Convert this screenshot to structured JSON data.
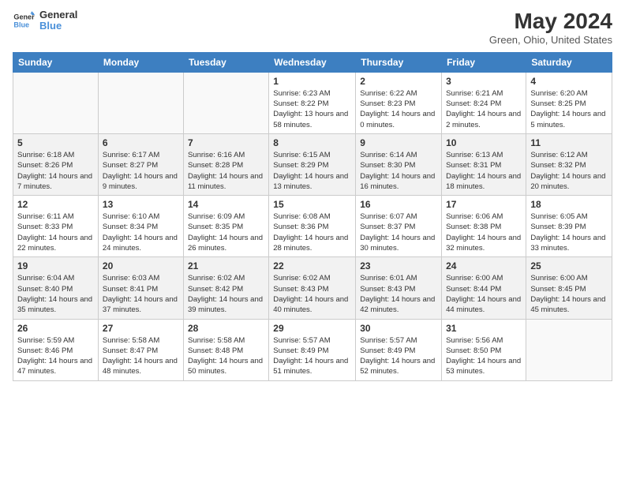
{
  "header": {
    "logo_line1": "General",
    "logo_line2": "Blue",
    "title": "May 2024",
    "subtitle": "Green, Ohio, United States"
  },
  "days_of_week": [
    "Sunday",
    "Monday",
    "Tuesday",
    "Wednesday",
    "Thursday",
    "Friday",
    "Saturday"
  ],
  "weeks": [
    [
      {
        "day": "",
        "empty": true
      },
      {
        "day": "",
        "empty": true
      },
      {
        "day": "",
        "empty": true
      },
      {
        "day": "1",
        "sunrise": "6:23 AM",
        "sunset": "8:22 PM",
        "daylight": "13 hours and 58 minutes."
      },
      {
        "day": "2",
        "sunrise": "6:22 AM",
        "sunset": "8:23 PM",
        "daylight": "14 hours and 0 minutes."
      },
      {
        "day": "3",
        "sunrise": "6:21 AM",
        "sunset": "8:24 PM",
        "daylight": "14 hours and 2 minutes."
      },
      {
        "day": "4",
        "sunrise": "6:20 AM",
        "sunset": "8:25 PM",
        "daylight": "14 hours and 5 minutes."
      }
    ],
    [
      {
        "day": "5",
        "sunrise": "6:18 AM",
        "sunset": "8:26 PM",
        "daylight": "14 hours and 7 minutes."
      },
      {
        "day": "6",
        "sunrise": "6:17 AM",
        "sunset": "8:27 PM",
        "daylight": "14 hours and 9 minutes."
      },
      {
        "day": "7",
        "sunrise": "6:16 AM",
        "sunset": "8:28 PM",
        "daylight": "14 hours and 11 minutes."
      },
      {
        "day": "8",
        "sunrise": "6:15 AM",
        "sunset": "8:29 PM",
        "daylight": "14 hours and 13 minutes."
      },
      {
        "day": "9",
        "sunrise": "6:14 AM",
        "sunset": "8:30 PM",
        "daylight": "14 hours and 16 minutes."
      },
      {
        "day": "10",
        "sunrise": "6:13 AM",
        "sunset": "8:31 PM",
        "daylight": "14 hours and 18 minutes."
      },
      {
        "day": "11",
        "sunrise": "6:12 AM",
        "sunset": "8:32 PM",
        "daylight": "14 hours and 20 minutes."
      }
    ],
    [
      {
        "day": "12",
        "sunrise": "6:11 AM",
        "sunset": "8:33 PM",
        "daylight": "14 hours and 22 minutes."
      },
      {
        "day": "13",
        "sunrise": "6:10 AM",
        "sunset": "8:34 PM",
        "daylight": "14 hours and 24 minutes."
      },
      {
        "day": "14",
        "sunrise": "6:09 AM",
        "sunset": "8:35 PM",
        "daylight": "14 hours and 26 minutes."
      },
      {
        "day": "15",
        "sunrise": "6:08 AM",
        "sunset": "8:36 PM",
        "daylight": "14 hours and 28 minutes."
      },
      {
        "day": "16",
        "sunrise": "6:07 AM",
        "sunset": "8:37 PM",
        "daylight": "14 hours and 30 minutes."
      },
      {
        "day": "17",
        "sunrise": "6:06 AM",
        "sunset": "8:38 PM",
        "daylight": "14 hours and 32 minutes."
      },
      {
        "day": "18",
        "sunrise": "6:05 AM",
        "sunset": "8:39 PM",
        "daylight": "14 hours and 33 minutes."
      }
    ],
    [
      {
        "day": "19",
        "sunrise": "6:04 AM",
        "sunset": "8:40 PM",
        "daylight": "14 hours and 35 minutes."
      },
      {
        "day": "20",
        "sunrise": "6:03 AM",
        "sunset": "8:41 PM",
        "daylight": "14 hours and 37 minutes."
      },
      {
        "day": "21",
        "sunrise": "6:02 AM",
        "sunset": "8:42 PM",
        "daylight": "14 hours and 39 minutes."
      },
      {
        "day": "22",
        "sunrise": "6:02 AM",
        "sunset": "8:43 PM",
        "daylight": "14 hours and 40 minutes."
      },
      {
        "day": "23",
        "sunrise": "6:01 AM",
        "sunset": "8:43 PM",
        "daylight": "14 hours and 42 minutes."
      },
      {
        "day": "24",
        "sunrise": "6:00 AM",
        "sunset": "8:44 PM",
        "daylight": "14 hours and 44 minutes."
      },
      {
        "day": "25",
        "sunrise": "6:00 AM",
        "sunset": "8:45 PM",
        "daylight": "14 hours and 45 minutes."
      }
    ],
    [
      {
        "day": "26",
        "sunrise": "5:59 AM",
        "sunset": "8:46 PM",
        "daylight": "14 hours and 47 minutes."
      },
      {
        "day": "27",
        "sunrise": "5:58 AM",
        "sunset": "8:47 PM",
        "daylight": "14 hours and 48 minutes."
      },
      {
        "day": "28",
        "sunrise": "5:58 AM",
        "sunset": "8:48 PM",
        "daylight": "14 hours and 50 minutes."
      },
      {
        "day": "29",
        "sunrise": "5:57 AM",
        "sunset": "8:49 PM",
        "daylight": "14 hours and 51 minutes."
      },
      {
        "day": "30",
        "sunrise": "5:57 AM",
        "sunset": "8:49 PM",
        "daylight": "14 hours and 52 minutes."
      },
      {
        "day": "31",
        "sunrise": "5:56 AM",
        "sunset": "8:50 PM",
        "daylight": "14 hours and 53 minutes."
      },
      {
        "day": "",
        "empty": true
      }
    ]
  ]
}
